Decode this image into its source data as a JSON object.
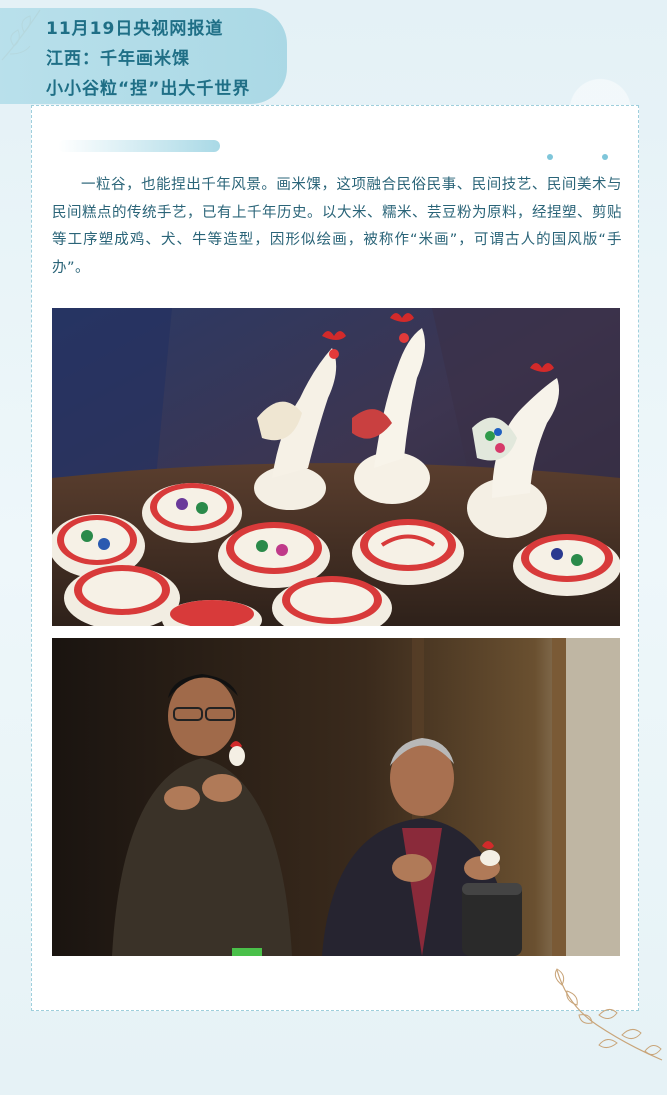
{
  "header": {
    "line1": "11月19日央视网报道",
    "line2": "江西：千年画米馃",
    "line3": "小小谷粒“捏”出大千世界"
  },
  "article": {
    "paragraph": "一粒谷，也能捏出千年风景。画米馃，这项融合民俗民事、民间技艺、民间美术与民间糕点的传统手艺，已有上千年历史。以大米、糯米、芸豆粉为原料，经捏塑、剪贴等工序塑成鸡、犬、牛等造型，因形似绘画，被称作“米画”，可谓古人的国风版“手办”。"
  },
  "colors": {
    "accent": "#1f6f86",
    "body_text": "#2a6478",
    "border": "#9fcfdc",
    "background": "#eaf4f8"
  },
  "icons": [
    "leaf-branch-icon",
    "leaf-sprig-icon"
  ]
}
